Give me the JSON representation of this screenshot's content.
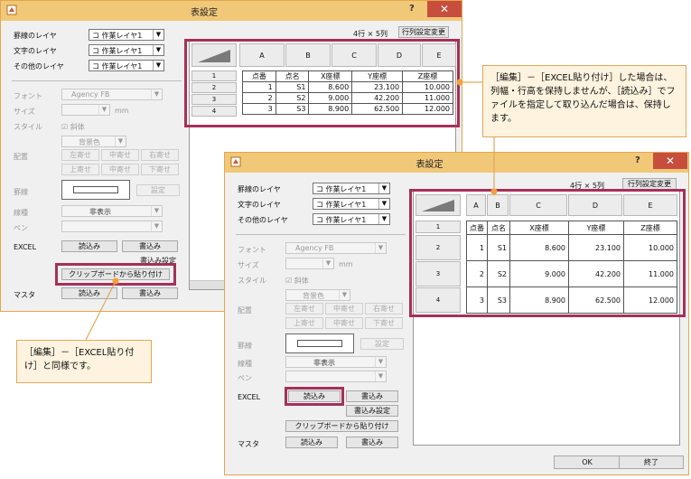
{
  "dialog": {
    "title": "表設定",
    "help": "?",
    "close": "✕",
    "row_col_info": "4行 × 5列",
    "change_button": "行列設定変更",
    "layer_table": "罫線のレイヤ",
    "layer_text": "文字のレイヤ",
    "layer_other": "その他のレイヤ",
    "layer_value": "コ 作業レイヤ1",
    "font_label": "フォント",
    "font_value": "Agency FB",
    "size_label": "サイズ",
    "size_unit": "mm",
    "style_label": "スタイル",
    "italic_label": "斜体",
    "bg_color": "背景色",
    "align_label": "配置",
    "align_buttons": [
      "左寄せ",
      "中寄せ",
      "右寄せ",
      "上寄せ",
      "中寄せ",
      "下寄せ"
    ],
    "border_label": "罫線",
    "setting_button": "設定",
    "linetype_label": "線種",
    "linetype_value": "非表示",
    "pen_label": "ペン",
    "excel_label": "EXCEL",
    "read_button": "読込み",
    "write_button": "書込み",
    "write_setting_button": "書込み設定",
    "clipboard_button": "クリップボードから貼り付け",
    "master_label": "マスタ",
    "ok_button": "OK",
    "exit_button": "終了"
  },
  "grid": {
    "columns": [
      "A",
      "B",
      "C",
      "D",
      "E"
    ],
    "row_numbers": [
      "1",
      "2",
      "3",
      "4"
    ],
    "header": [
      "点番",
      "点名",
      "X座標",
      "Y座標",
      "Z座標"
    ],
    "rows": [
      [
        "1",
        "S1",
        "8.600",
        "23.100",
        "10.000"
      ],
      [
        "2",
        "S2",
        "9.000",
        "42.200",
        "11.000"
      ],
      [
        "3",
        "S3",
        "8.900",
        "62.500",
        "12.000"
      ]
    ]
  },
  "callouts": {
    "right": "［編集］－［EXCEL貼り付け］した場合は、列幅・行高を保持しませんが、［読込み］でファイルを指定して取り込んだ場合は、保持します。",
    "left": "［編集］－［EXCEL貼り付け］と同様です。"
  },
  "colors": {
    "titlebar": "#f0c878",
    "highlight": "#a6305a",
    "callout_bg": "#fdf3df",
    "close": "#c74e3d"
  }
}
